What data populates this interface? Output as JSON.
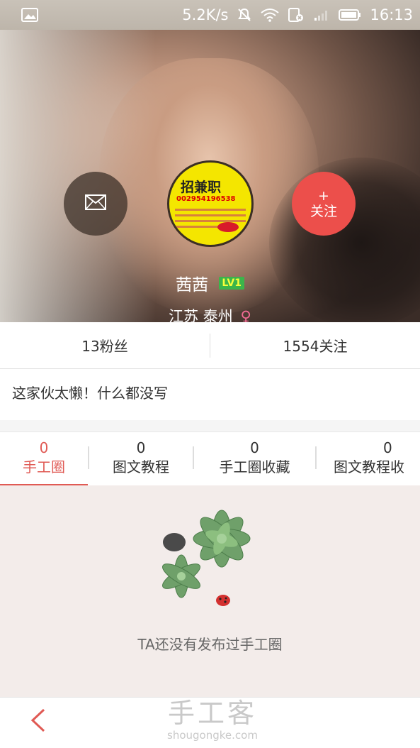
{
  "status_bar": {
    "speed": "5.2K/s",
    "time": "16:13",
    "icons": [
      "gallery-icon",
      "mute-icon",
      "wifi-icon",
      "sim-icon",
      "signal-icon",
      "battery-icon"
    ]
  },
  "profile": {
    "avatar_text_main": "招兼职",
    "avatar_text_phone": "002954196538",
    "name": "茜茜",
    "level": "LV1",
    "province": "江苏",
    "city": "泰州",
    "follow_plus": "+",
    "follow_label": "关注"
  },
  "counts": {
    "fans": "13粉丝",
    "following": "1554关注"
  },
  "bio": "这家伙太懒！什么都没写",
  "tabs": [
    {
      "count": "0",
      "label": "手工圈",
      "active": true
    },
    {
      "count": "0",
      "label": "图文教程"
    },
    {
      "count": "0",
      "label": "手工圈收藏"
    },
    {
      "count": "0",
      "label": "图文教程收"
    }
  ],
  "empty_state": {
    "text": "TA还没有发布过手工圈"
  },
  "watermark": {
    "brand": "手工客",
    "domain": "shougongke.com"
  },
  "colors": {
    "accent": "#e05a54",
    "follow_button": "#ec4f4b",
    "level_badge": "#3bb54a"
  }
}
